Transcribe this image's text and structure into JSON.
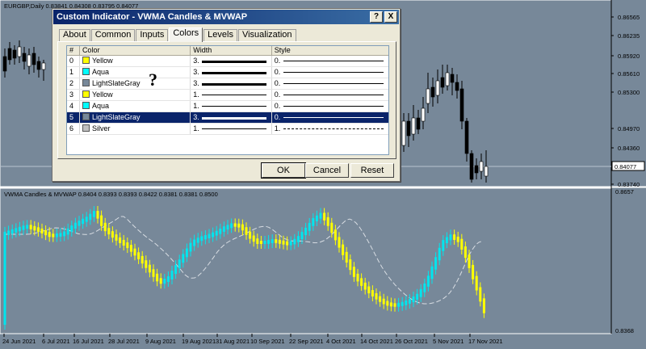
{
  "main_chart": {
    "header": "EURGBP,Daily  0.83841 0.84308 0.83795 0.84077",
    "price_axis": [
      "0.86565",
      "0.86235",
      "0.85920",
      "0.85610",
      "0.85300",
      "0.84970",
      "0.84360",
      "0.83740"
    ],
    "current_price": "0.84077"
  },
  "indicator": {
    "header": "VWMA Candles & MVWAP 0.8404 0.8393 0.8393 0.8422 0.8381 0.8381 0.8500",
    "axis_top": "0.8657",
    "axis_bottom": "0.8368"
  },
  "time_axis": [
    "24 Jun 2021",
    "6 Jul 2021",
    "16 Jul 2021",
    "28 Jul 2021",
    "9 Aug 2021",
    "19 Aug 2021",
    "31 Aug 2021",
    "10 Sep 2021",
    "22 Sep 2021",
    "4 Oct 2021",
    "14 Oct 2021",
    "26 Oct 2021",
    "5 Nov 2021",
    "17 Nov 2021"
  ],
  "dialog": {
    "title": "Custom Indicator - VWMA Candles & MVWAP",
    "help_glyph": "?",
    "close_glyph": "X",
    "tabs": [
      "About",
      "Common",
      "Inputs",
      "Colors",
      "Levels",
      "Visualization"
    ],
    "active_tab": "Colors",
    "columns": [
      "#",
      "Color",
      "Width",
      "Style"
    ],
    "rows": [
      {
        "index": "0",
        "color_name": "Yellow",
        "swatch": "#ffff00",
        "width": "3.",
        "style": "0."
      },
      {
        "index": "1",
        "color_name": "Aqua",
        "swatch": "#00ffff",
        "width": "3.",
        "style": "0."
      },
      {
        "index": "2",
        "color_name": "LightSlateGray",
        "swatch": "#778899",
        "width": "3.",
        "style": "0."
      },
      {
        "index": "3",
        "color_name": "Yellow",
        "swatch": "#ffff00",
        "width": "1.",
        "style": "0."
      },
      {
        "index": "4",
        "color_name": "Aqua",
        "swatch": "#00ffff",
        "width": "1.",
        "style": "0."
      },
      {
        "index": "5",
        "color_name": "LightSlateGray",
        "swatch": "#778899",
        "width": "3.",
        "style": "0."
      },
      {
        "index": "6",
        "color_name": "Silver",
        "swatch": "#c0c0c0",
        "width": "1.",
        "style": "1."
      }
    ],
    "selected_row": 5,
    "overlay_mark": "?",
    "buttons": {
      "ok": "OK",
      "cancel": "Cancel",
      "reset": "Reset"
    }
  },
  "colors": {
    "background": "#778899",
    "bull": "#00e5ee",
    "bear": "#ffff00",
    "selection": "#0a246a"
  }
}
